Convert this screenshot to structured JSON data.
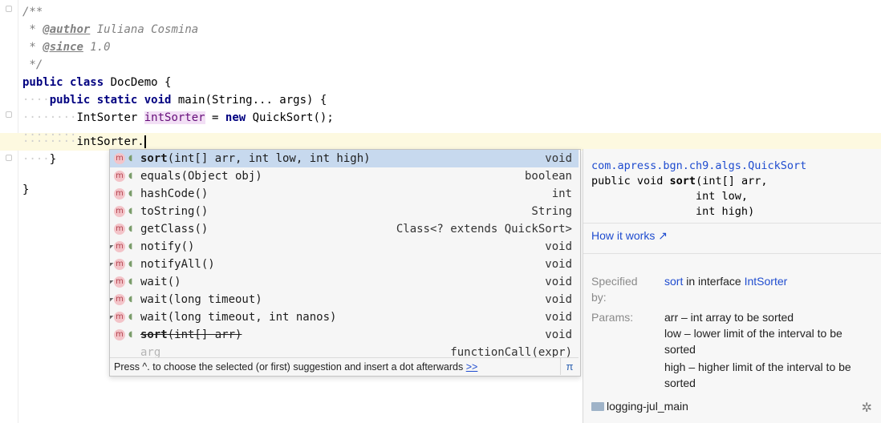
{
  "editor": {
    "lines": {
      "l1": "/**",
      "l2_prefix": " * ",
      "l2_tag": "@author",
      "l2_text": " Iuliana Cosmina",
      "l3_prefix": " * ",
      "l3_tag": "@since",
      "l3_text": " 1.0",
      "l4": " */",
      "l5_kw": "public class",
      "l5_text": " DocDemo {",
      "l6_kw": "public static void",
      "l6_text": " main(String... args) {",
      "l7_type": "IntSorter ",
      "l7_var": "intSorter",
      "l7_eq": " = ",
      "l7_kw": "new",
      "l7_rest": " QuickSort();",
      "l9_text": "intSorter.",
      "l10_text": "}",
      "l12_text": "}"
    }
  },
  "completion": {
    "items": [
      {
        "name": "sort",
        "params": "(int[] arr, int low, int high)",
        "ret": "void"
      },
      {
        "name": "equals",
        "params": "(Object obj)",
        "ret": "boolean"
      },
      {
        "name": "hashCode",
        "params": "()",
        "ret": "int"
      },
      {
        "name": "toString",
        "params": "()",
        "ret": "String"
      },
      {
        "name": "getClass",
        "params": "()",
        "ret": "Class<? extends QuickSort>"
      },
      {
        "name": "notify",
        "params": "()",
        "ret": "void"
      },
      {
        "name": "notifyAll",
        "params": "()",
        "ret": "void"
      },
      {
        "name": "wait",
        "params": "()",
        "ret": "void"
      },
      {
        "name": "wait",
        "params": "(long timeout)",
        "ret": "void"
      },
      {
        "name": "wait",
        "params": "(long timeout, int nanos)",
        "ret": "void"
      },
      {
        "name": "sort",
        "params": "(int[] arr)",
        "ret": "void"
      },
      {
        "name": "arg",
        "params": "",
        "ret": "functionCall(expr)"
      }
    ],
    "icon_letter": "m",
    "hint_text": "Press ^. to choose the selected (or first) suggestion and insert a dot afterwards",
    "hint_more": ">>",
    "pi_symbol": "π"
  },
  "doc": {
    "class_path": "com.apress.bgn.ch9.algs.QuickSort",
    "sig_prefix": "public void ",
    "sig_name": "sort",
    "sig_l1_rest": "(int[] arr,",
    "sig_l2": "                int low,",
    "sig_l3": "                int high)",
    "how_it_works": "How it works ↗",
    "specified_label": "Specified by:",
    "specified_method": "sort",
    "specified_mid": " in interface ",
    "specified_iface": "IntSorter",
    "params_label": "Params:",
    "param1": "arr – int array to be sorted",
    "param2": "low – lower limit of the interval to be sorted",
    "param3": "high – higher limit of the interval to be sorted",
    "module": "logging-jul_main",
    "gear": "✲"
  },
  "colors": {
    "selection": "#c7d9ee",
    "link": "#1f4ccf",
    "keyword": "#000080"
  }
}
